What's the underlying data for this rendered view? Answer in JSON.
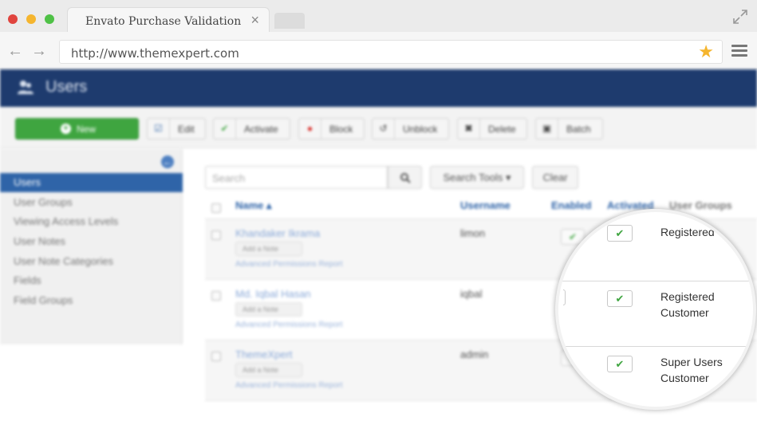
{
  "browser": {
    "tab_title": "Envato Purchase Validation",
    "tab_close": "×",
    "url": "http://www.themexpert.com",
    "back_icon": "arrow-left-icon",
    "forward_icon": "arrow-right-icon",
    "bookmark_icon": "star-icon",
    "colors": {
      "star": "#f5b52e",
      "close": "#e0443e",
      "minimize": "#f5b52e",
      "maximize": "#4fc146"
    }
  },
  "app": {
    "title": "Users",
    "colors": {
      "header": "#1e3b6e",
      "new_button": "#3fa540",
      "active_item": "#2f64a8"
    },
    "toolbar": {
      "new": "New",
      "edit": "Edit",
      "activate": "Activate",
      "block": "Block",
      "unblock": "Unblock",
      "delete": "Delete",
      "batch": "Batch"
    },
    "sidebar": {
      "items": [
        {
          "label": "Users",
          "active": true
        },
        {
          "label": "User Groups"
        },
        {
          "label": "Viewing Access Levels"
        },
        {
          "label": "User Notes"
        },
        {
          "label": "User Note Categories"
        },
        {
          "label": "Fields"
        },
        {
          "label": "Field Groups"
        }
      ]
    },
    "search": {
      "placeholder": "Search",
      "tools_label": "Search Tools ▾",
      "clear_label": "Clear"
    },
    "table": {
      "headers": {
        "name": "Name ▴",
        "username": "Username",
        "enabled": "Enabled",
        "activated": "Activated",
        "groups": "User Groups"
      },
      "rows": [
        {
          "name": "Khandaker Ikrama",
          "note": "Add a Note",
          "perm": "Advanced Permissions Report",
          "username": "limon",
          "groups": [
            "Registered"
          ]
        },
        {
          "name": "Md. Iqbal Hasan",
          "note": "Add a Note",
          "perm": "Advanced Permissions Report",
          "username": "iqbal",
          "groups": [
            "Registered",
            "Customer"
          ]
        },
        {
          "name": "ThemeXpert",
          "note": "Add a Note",
          "perm": "Advanced Permissions Report",
          "username": "admin",
          "groups": [
            "Super Users",
            "Customer"
          ]
        }
      ]
    },
    "check_mark": "✔"
  }
}
